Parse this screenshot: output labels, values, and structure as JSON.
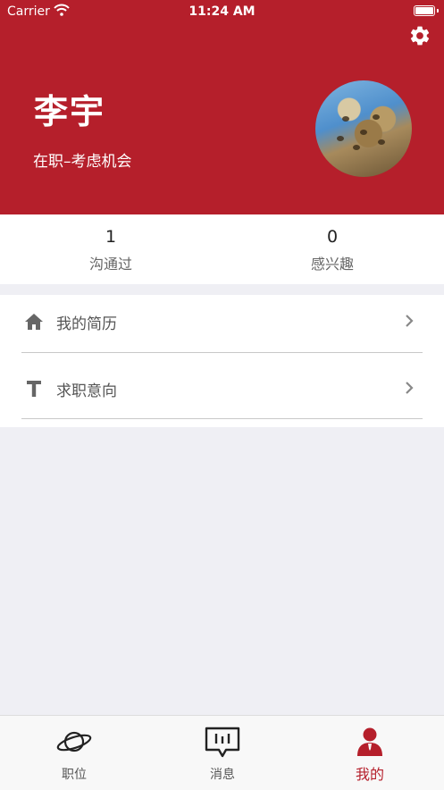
{
  "status_bar": {
    "carrier": "Carrier",
    "time": "11:24 AM"
  },
  "profile": {
    "name": "李宇",
    "job_status": "在职–考虑机会"
  },
  "stats": [
    {
      "value": "1",
      "label": "沟通过"
    },
    {
      "value": "0",
      "label": "感兴趣"
    }
  ],
  "menu": [
    {
      "label": "我的简历",
      "icon": "home-icon"
    },
    {
      "label": "求职意向",
      "icon": "text-t-icon"
    }
  ],
  "tabs": [
    {
      "label": "职位",
      "icon": "planet-icon",
      "active": false
    },
    {
      "label": "消息",
      "icon": "chat-icon",
      "active": false
    },
    {
      "label": "我的",
      "icon": "user-icon",
      "active": true
    }
  ],
  "colors": {
    "accent": "#b51f2b",
    "background": "#efeff4",
    "tabbar": "#f8f8f8"
  }
}
